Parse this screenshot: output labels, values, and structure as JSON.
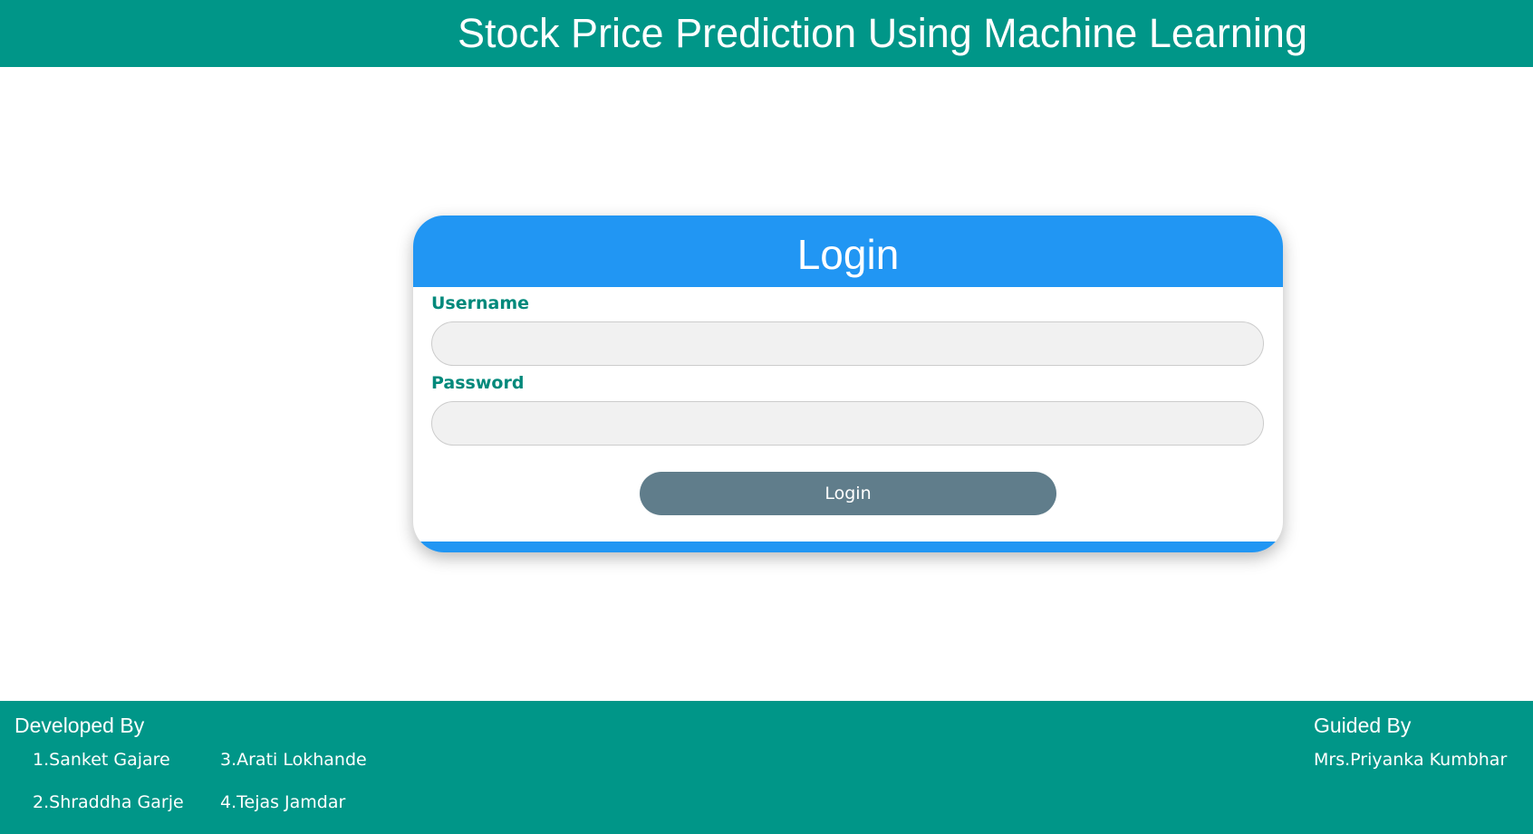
{
  "header": {
    "title": "Stock Price Prediction Using Machine Learning"
  },
  "login_card": {
    "title": "Login",
    "username_label": "Username",
    "username_value": "",
    "password_label": "Password",
    "password_value": "",
    "submit_label": "Login"
  },
  "footer": {
    "developed_heading": "Developed By",
    "developers": [
      "1.Sanket Gajare",
      "2.Shraddha Garje",
      "3.Arati Lokhande",
      "4.Tejas Jamdar"
    ],
    "guided_heading": "Guided By",
    "guide": "Mrs.Priyanka Kumbhar"
  },
  "colors": {
    "header_bg": "#009688",
    "card_accent": "#2196f3",
    "label_color": "#00897b",
    "button_bg": "#607d8b",
    "input_bg": "#f1f1f1"
  }
}
